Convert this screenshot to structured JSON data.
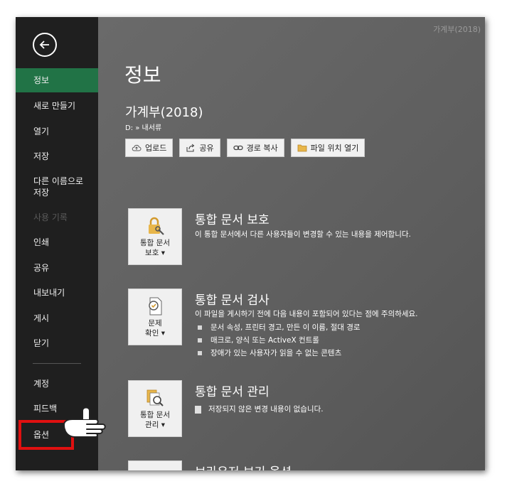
{
  "window": {
    "title": "가계부(2018)"
  },
  "sidebar": {
    "items": [
      {
        "label": "정보"
      },
      {
        "label": "새로 만들기"
      },
      {
        "label": "열기"
      },
      {
        "label": "저장"
      },
      {
        "label": "다른 이름으로",
        "label2": "저장"
      },
      {
        "label": "사용 기록"
      },
      {
        "label": "인쇄"
      },
      {
        "label": "공유"
      },
      {
        "label": "내보내기"
      },
      {
        "label": "게시"
      },
      {
        "label": "닫기"
      },
      {
        "label": "계정"
      },
      {
        "label": "피드백"
      },
      {
        "label": "옵션"
      }
    ]
  },
  "main": {
    "title": "정보",
    "doc_name": "가계부(2018)",
    "doc_path": "D: » 내서류",
    "buttons": [
      {
        "label": "업로드",
        "icon": "upload-cloud-icon"
      },
      {
        "label": "공유",
        "icon": "share-icon"
      },
      {
        "label": "경로 복사",
        "icon": "link-icon"
      },
      {
        "label": "파일 위치 열기",
        "icon": "folder-icon"
      }
    ],
    "sections": [
      {
        "tile_label_1": "통합 문서",
        "tile_label_2": "보호 ▾",
        "title": "통합 문서 보호",
        "desc": "이 통합 문서에서 다른 사용자들이 변경할 수 있는 내용을 제어합니다.",
        "icon": "lock-icon"
      },
      {
        "tile_label_1": "문제",
        "tile_label_2": "확인 ▾",
        "title": "통합 문서 검사",
        "desc": "이 파일을 게시하기 전에 다음 내용이 포함되어 있다는 점에 주의하세요.",
        "bullets": [
          "문서 속성, 프린터 경고, 만든 이 이름, 절대 경로",
          "매크로, 양식 또는 ActiveX 컨트롤",
          "장애가 있는 사용자가 읽을 수 없는 콘텐츠"
        ],
        "icon": "check-document-icon"
      },
      {
        "tile_label_1": "통합 문서",
        "tile_label_2": "관리 ▾",
        "title": "통합 문서 관리",
        "desc": "저장되지 않은 변경 내용이 없습니다.",
        "icon": "manage-document-icon"
      }
    ],
    "partial_section_title": "브라우저 보기 옵션"
  },
  "colors": {
    "accent": "#217346",
    "highlight": "#e01010",
    "sidebar_bg": "#1f1f1f"
  }
}
